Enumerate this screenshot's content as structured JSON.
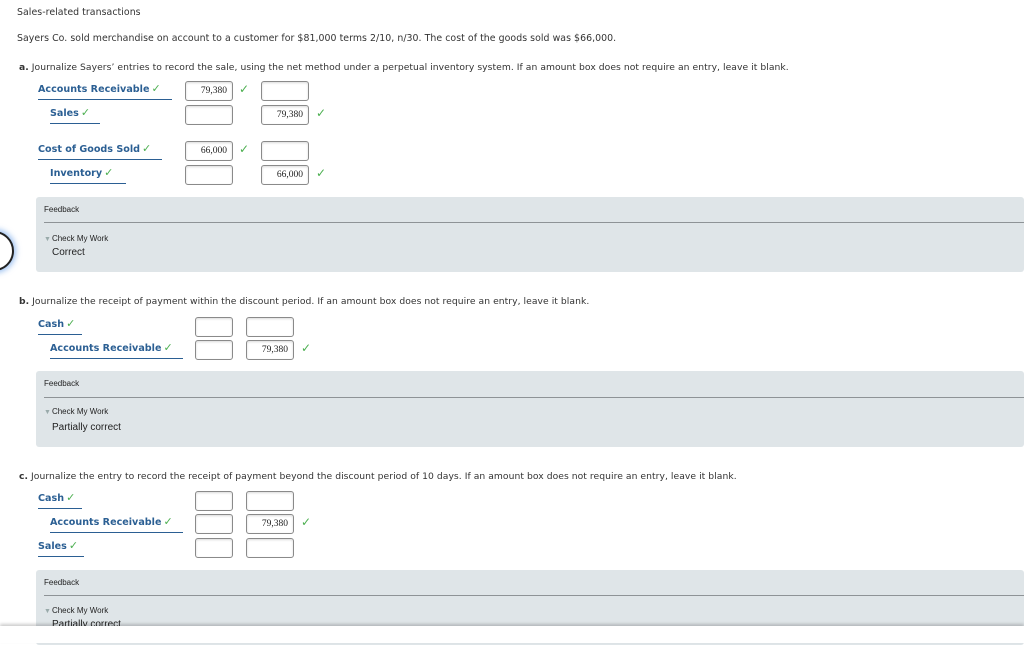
{
  "page": {
    "title": "Sales-related transactions",
    "intro": "Sayers Co. sold merchandise on account to a customer for $81,000 terms 2/10, n/30. The cost of the goods sold was $66,000."
  },
  "check_glyph": "✓",
  "parts": {
    "a": {
      "label": "a.",
      "prompt": "Journalize Sayers’ entries to record the sale, using the net method under a perpetual inventory system. If an amount box does not require an entry, leave it blank.",
      "rows": [
        {
          "account": "Accounts Receivable",
          "debit": "79,380",
          "credit": "",
          "debit_correct": true,
          "credit_correct": false
        },
        {
          "account": "Sales",
          "debit": "",
          "credit": "79,380",
          "debit_correct": false,
          "credit_correct": true
        },
        {
          "account": "Cost of Goods Sold",
          "debit": "66,000",
          "credit": "",
          "debit_correct": true,
          "credit_correct": false
        },
        {
          "account": "Inventory",
          "debit": "",
          "credit": "66,000",
          "debit_correct": false,
          "credit_correct": true
        }
      ],
      "feedback": {
        "header": "Feedback",
        "toggle": "Check My Work",
        "result": "Correct"
      }
    },
    "b": {
      "label": "b.",
      "prompt": "Journalize the receipt of payment within the discount period. If an amount box does not require an entry, leave it blank.",
      "rows": [
        {
          "account": "Cash",
          "debit": "",
          "credit": ""
        },
        {
          "account": "Accounts Receivable",
          "debit": "",
          "credit": "79,380",
          "credit_correct": true
        }
      ],
      "feedback": {
        "header": "Feedback",
        "toggle": "Check My Work",
        "result": "Partially correct"
      }
    },
    "c": {
      "label": "c.",
      "prompt": "Journalize the entry to record the receipt of payment beyond the discount period of 10 days. If an amount box does not require an entry, leave it blank.",
      "rows": [
        {
          "account": "Cash",
          "debit": "",
          "credit": ""
        },
        {
          "account": "Accounts Receivable",
          "debit": "",
          "credit": "79,380",
          "credit_correct": true
        },
        {
          "account": "Sales",
          "debit": "",
          "credit": ""
        }
      ],
      "feedback": {
        "header": "Feedback",
        "toggle": "Check My Work",
        "result": "Partially correct"
      }
    }
  }
}
